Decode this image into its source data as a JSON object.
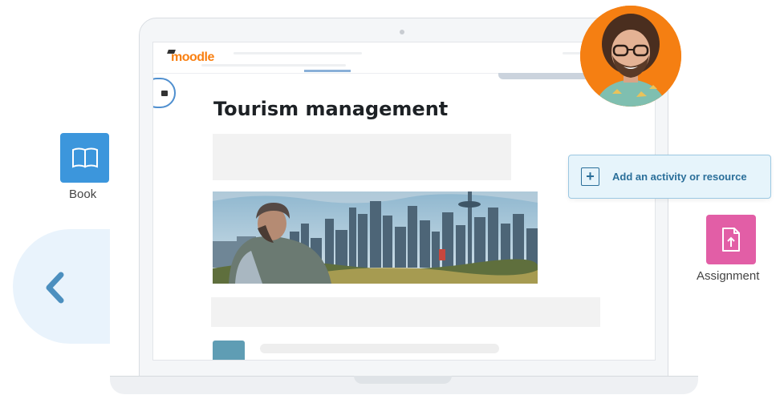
{
  "app": {
    "logo_text": "moodle",
    "brand_color": "#f98012"
  },
  "course": {
    "title": "Tourism management"
  },
  "actions": {
    "add_activity_label": "Add an activity or resource",
    "add_activity_icon": "plus-icon"
  },
  "tiles": {
    "book": {
      "label": "Book",
      "icon": "book-icon",
      "color": "#3c96dc"
    },
    "assignment": {
      "label": "Assignment",
      "icon": "file-upload-icon",
      "color": "#e25ea6"
    }
  },
  "navigation": {
    "back_icon": "chevron-left-icon"
  },
  "colors": {
    "accent": "#2b6f9a",
    "avatar_bg": "#f57f12"
  }
}
